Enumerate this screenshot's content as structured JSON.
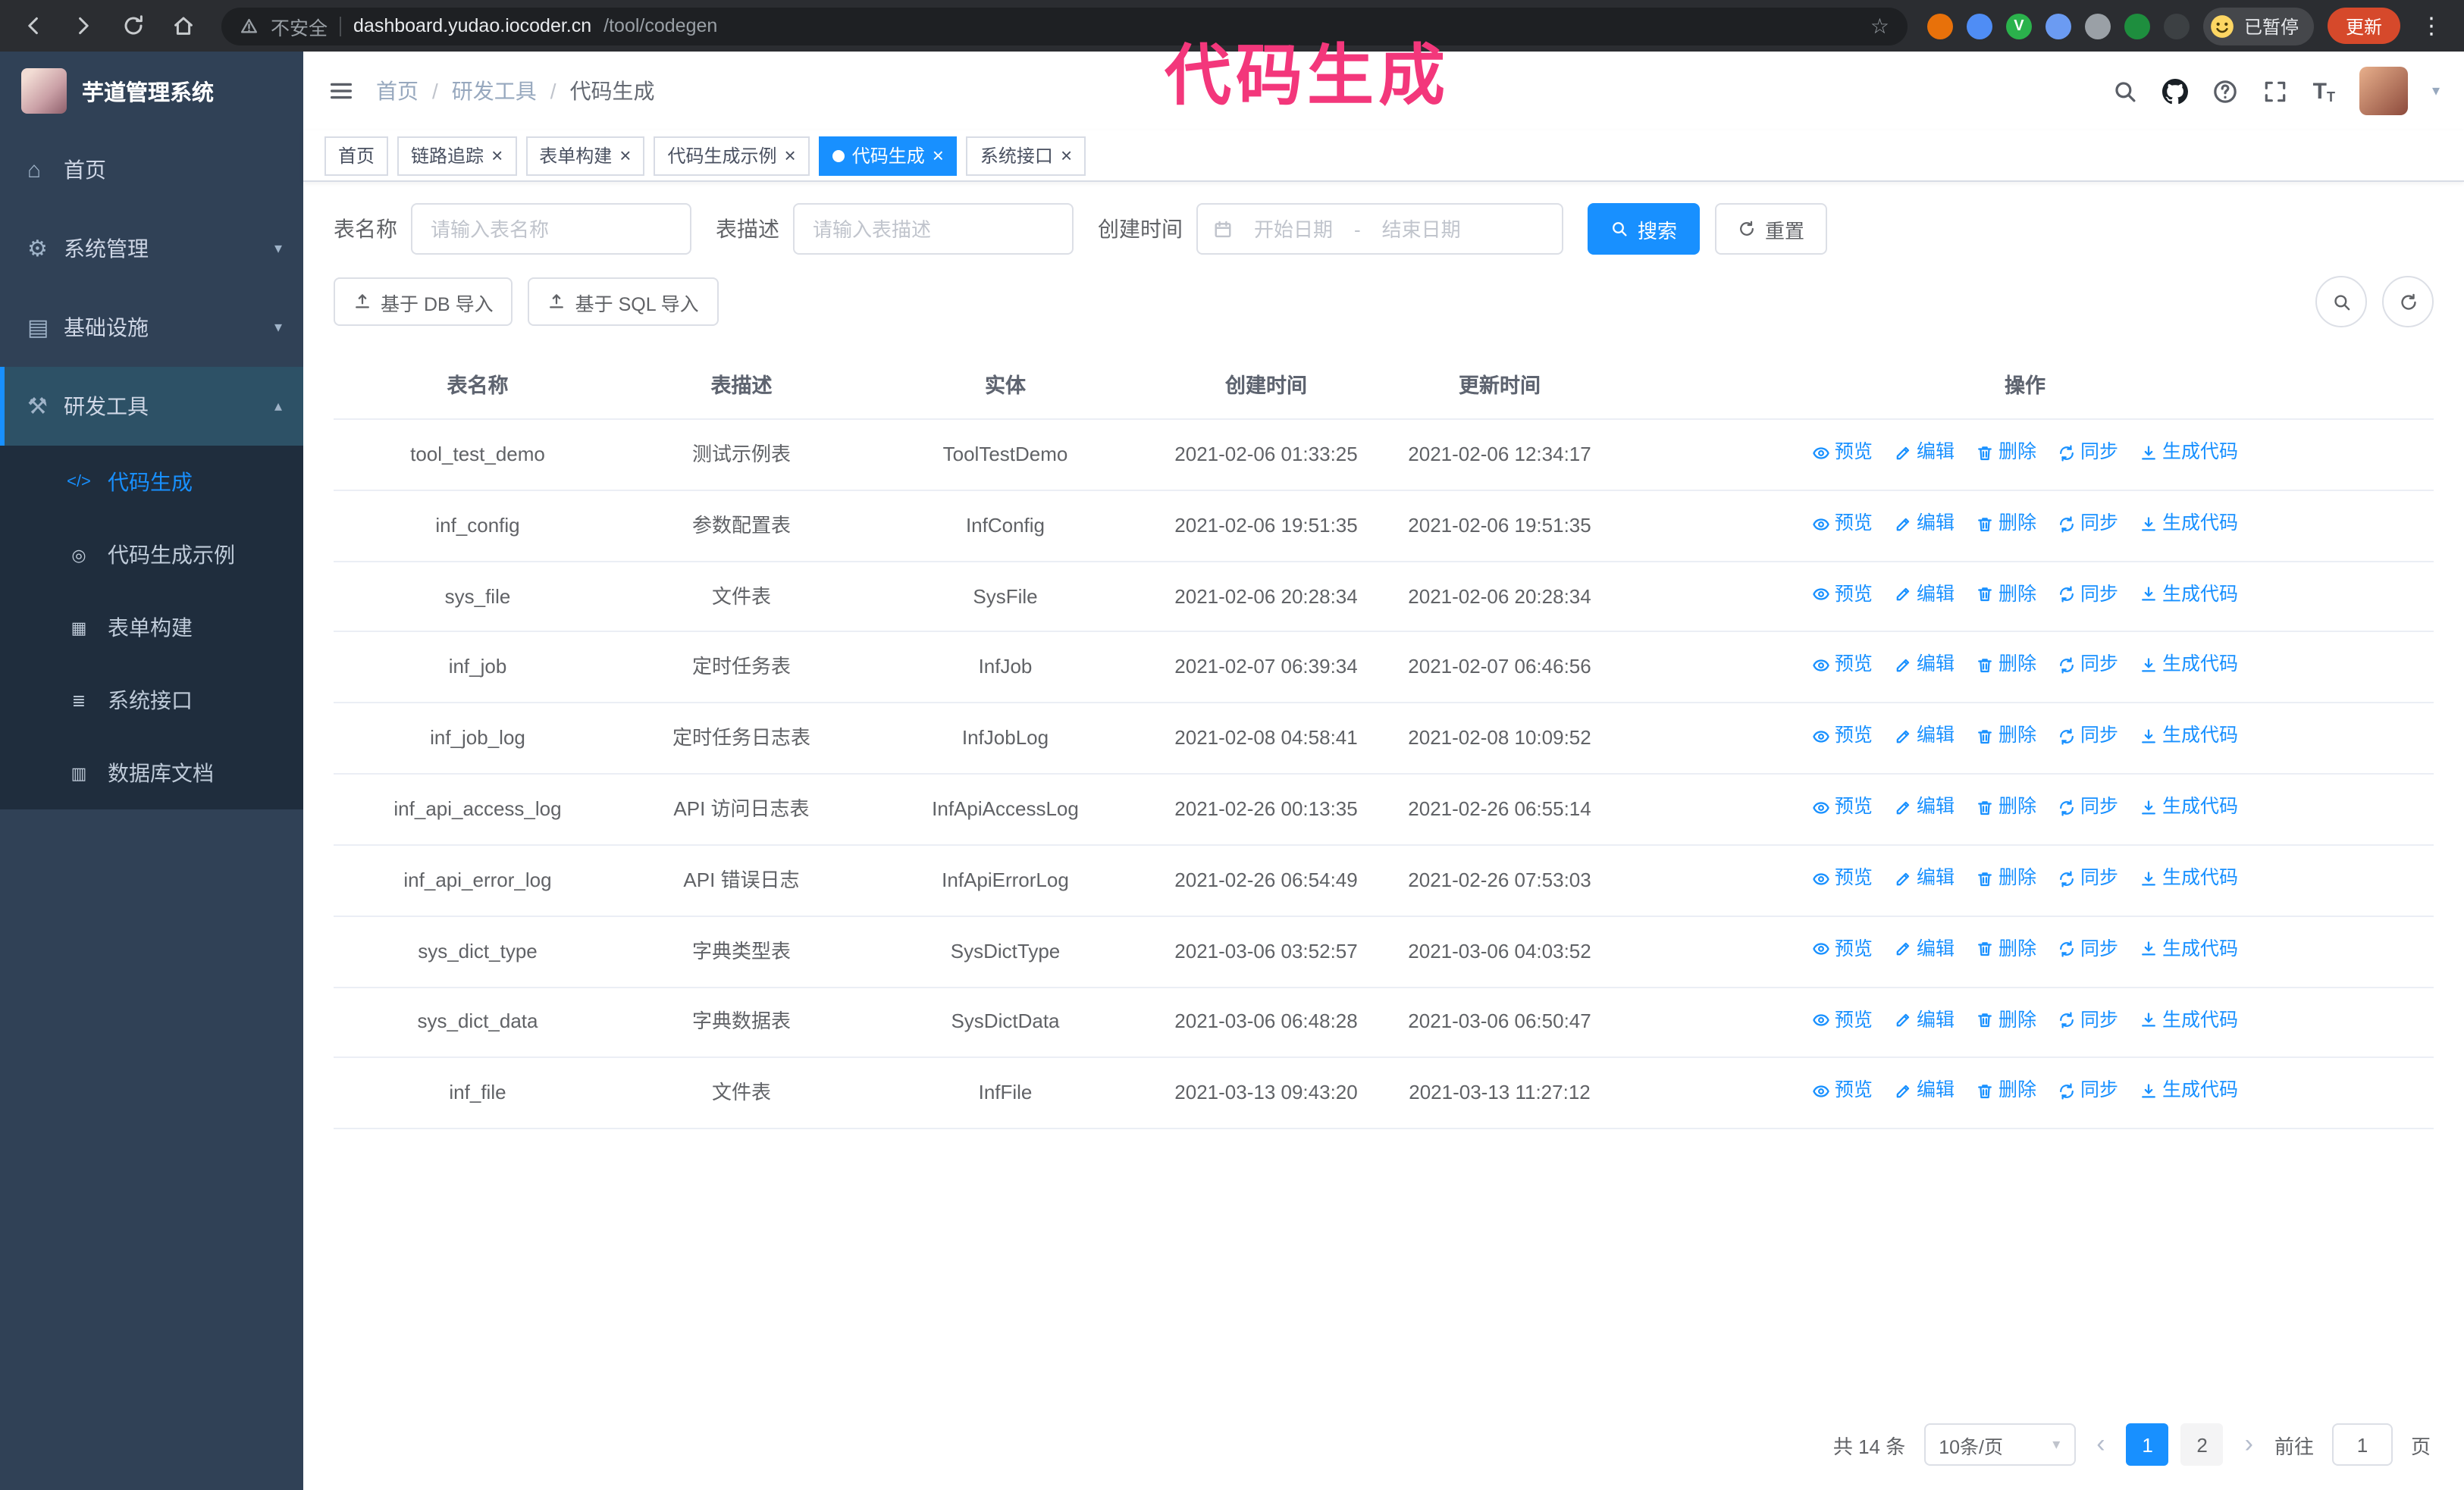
{
  "colors": {
    "primary": "#1890ff",
    "sidebar": "#304156",
    "submenu": "#1f2d3d",
    "annotation": "#f3377b",
    "update": "#d6492b"
  },
  "icons": {
    "home": "⌂",
    "system": "⚙",
    "infra": "▤",
    "tools": "⚒",
    "code": "</>",
    "example": "◎",
    "form": "▦",
    "api": "≣",
    "db": "▥",
    "close": "×",
    "prev": "‹",
    "next": "›",
    "caret_down": "▾",
    "kebab": "⋮",
    "star": "☆"
  },
  "annotation": {
    "text": "代码生成"
  },
  "browser": {
    "security_label": "不安全",
    "url_domain": "dashboard.yudao.iocoder.cn",
    "url_path": "/tool/codegen",
    "profile_badge": "已暂停",
    "update_button": "更新",
    "extensions": [
      {
        "name": "extension-orange",
        "color": "#e8710a",
        "letter": ""
      },
      {
        "name": "extension-drop",
        "color": "#4f8df5",
        "letter": ""
      },
      {
        "name": "extension-green-v",
        "color": "#2bb24c",
        "letter": "V"
      },
      {
        "name": "extension-people",
        "color": "#6b9bf2",
        "letter": ""
      },
      {
        "name": "extension-card",
        "color": "#9aa0a6",
        "letter": ""
      },
      {
        "name": "extension-leaf",
        "color": "#1e8e3e",
        "letter": ""
      },
      {
        "name": "extension-puzzle",
        "color": "#3c4043",
        "letter": ""
      }
    ]
  },
  "sidebar": {
    "logo_title": "芋道管理系统",
    "menu": [
      {
        "label": "首页",
        "icon": "home",
        "caret": ""
      },
      {
        "label": "系统管理",
        "icon": "system",
        "caret": "▾"
      },
      {
        "label": "基础设施",
        "icon": "infra",
        "caret": "▾"
      },
      {
        "label": "研发工具",
        "icon": "tools",
        "caret": "▴",
        "active": true
      }
    ],
    "submenu": [
      {
        "label": "代码生成",
        "icon": "code",
        "active": true
      },
      {
        "label": "代码生成示例",
        "icon": "example"
      },
      {
        "label": "表单构建",
        "icon": "form"
      },
      {
        "label": "系统接口",
        "icon": "api"
      },
      {
        "label": "数据库文档",
        "icon": "db"
      }
    ]
  },
  "header": {
    "breadcrumb": [
      {
        "label": "首页"
      },
      {
        "label": "研发工具"
      },
      {
        "label": "代码生成"
      }
    ]
  },
  "tabs": [
    {
      "label": "首页"
    },
    {
      "label": "链路追踪",
      "closable": true
    },
    {
      "label": "表单构建",
      "closable": true
    },
    {
      "label": "代码生成示例",
      "closable": true
    },
    {
      "label": "代码生成",
      "closable": true,
      "active": true
    },
    {
      "label": "系统接口",
      "closable": true
    }
  ],
  "filters": {
    "table_name_label": "表名称",
    "table_name_placeholder": "请输入表名称",
    "table_desc_label": "表描述",
    "table_desc_placeholder": "请输入表描述",
    "create_time_label": "创建时间",
    "date_start_placeholder": "开始日期",
    "date_separator": "-",
    "date_end_placeholder": "结束日期",
    "search_button": "搜索",
    "reset_button": "重置"
  },
  "toolbar": {
    "import_db_button": "基于 DB 导入",
    "import_sql_button": "基于 SQL 导入"
  },
  "table": {
    "columns": [
      "表名称",
      "表描述",
      "实体",
      "创建时间",
      "更新时间",
      "操作"
    ],
    "actions": [
      "预览",
      "编辑",
      "删除",
      "同步",
      "生成代码"
    ],
    "rows": [
      {
        "name": "tool_test_demo",
        "desc": "测试示例表",
        "entity": "ToolTestDemo",
        "created": "2021-02-06 01:33:25",
        "updated": "2021-02-06 12:34:17"
      },
      {
        "name": "inf_config",
        "desc": "参数配置表",
        "entity": "InfConfig",
        "created": "2021-02-06 19:51:35",
        "updated": "2021-02-06 19:51:35"
      },
      {
        "name": "sys_file",
        "desc": "文件表",
        "entity": "SysFile",
        "created": "2021-02-06 20:28:34",
        "updated": "2021-02-06 20:28:34"
      },
      {
        "name": "inf_job",
        "desc": "定时任务表",
        "entity": "InfJob",
        "created": "2021-02-07 06:39:34",
        "updated": "2021-02-07 06:46:56"
      },
      {
        "name": "inf_job_log",
        "desc": "定时任务日志表",
        "entity": "InfJobLog",
        "created": "2021-02-08 04:58:41",
        "updated": "2021-02-08 10:09:52"
      },
      {
        "name": "inf_api_access_log",
        "desc": "API 访问日志表",
        "entity": "InfApiAccessLog",
        "created": "2021-02-26 00:13:35",
        "updated": "2021-02-26 06:55:14"
      },
      {
        "name": "inf_api_error_log",
        "desc": "API 错误日志",
        "entity": "InfApiErrorLog",
        "created": "2021-02-26 06:54:49",
        "updated": "2021-02-26 07:53:03"
      },
      {
        "name": "sys_dict_type",
        "desc": "字典类型表",
        "entity": "SysDictType",
        "created": "2021-03-06 03:52:57",
        "updated": "2021-03-06 04:03:52"
      },
      {
        "name": "sys_dict_data",
        "desc": "字典数据表",
        "entity": "SysDictData",
        "created": "2021-03-06 06:48:28",
        "updated": "2021-03-06 06:50:47"
      },
      {
        "name": "inf_file",
        "desc": "文件表",
        "entity": "InfFile",
        "created": "2021-03-13 09:43:20",
        "updated": "2021-03-13 11:27:12"
      }
    ]
  },
  "pagination": {
    "total": "共 14 条",
    "page_size": "10条/页",
    "pages": [
      {
        "label": "1",
        "active": true
      },
      {
        "label": "2"
      }
    ],
    "goto_label": "前往",
    "goto_value": "1",
    "goto_unit": "页"
  }
}
